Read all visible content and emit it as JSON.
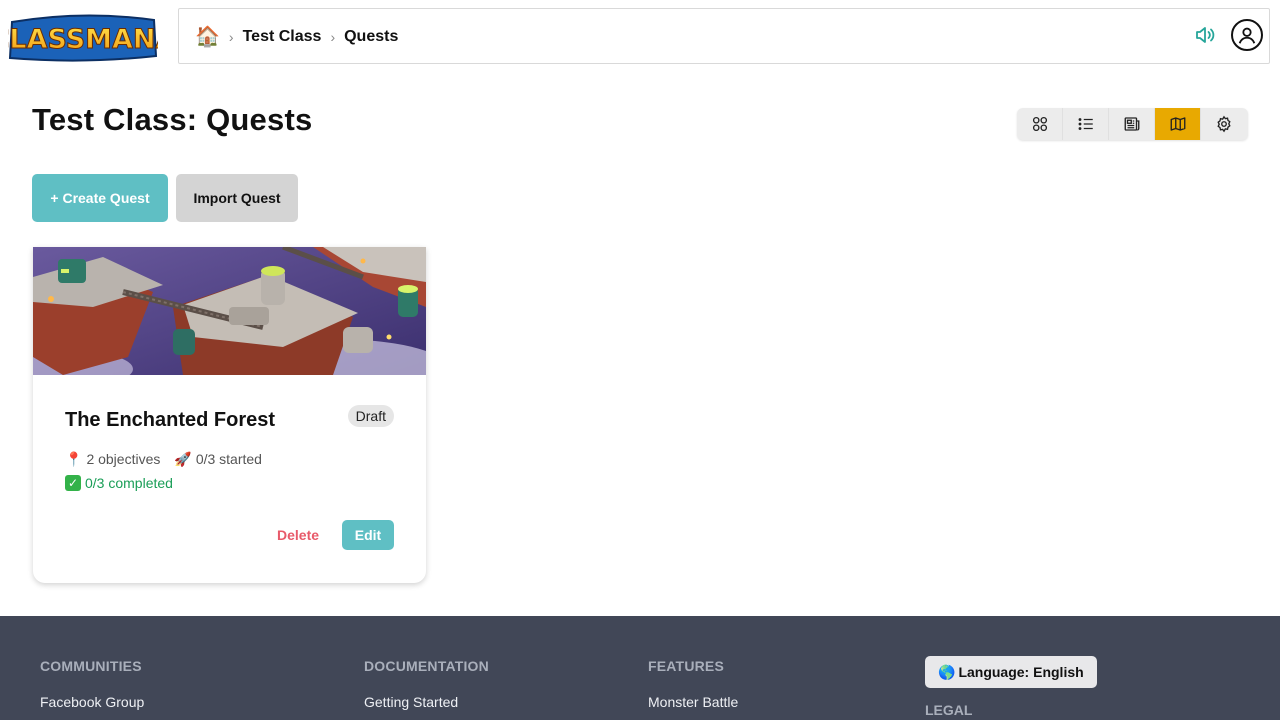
{
  "app": {
    "logo_text": "CLASSMANA"
  },
  "breadcrumb": {
    "home_icon": "house-icon",
    "items": [
      {
        "label": "Test Class"
      },
      {
        "label": "Quests"
      }
    ]
  },
  "page": {
    "title": "Test Class: Quests"
  },
  "view_toggle": {
    "buttons": [
      {
        "icon": "grid-icon",
        "active": false
      },
      {
        "icon": "list-icon",
        "active": false
      },
      {
        "icon": "newspaper-icon",
        "active": false
      },
      {
        "icon": "map-icon",
        "active": true
      },
      {
        "icon": "gear-icon",
        "active": false
      }
    ],
    "active_color": "#e8a901"
  },
  "actions": {
    "create_label": "+ Create Quest",
    "import_label": "Import Quest"
  },
  "quests": [
    {
      "title": "The Enchanted Forest",
      "status": "Draft",
      "objectives": "2 objectives",
      "started": "0/3 started",
      "completed": "0/3 completed",
      "delete_label": "Delete",
      "edit_label": "Edit"
    }
  ],
  "footer": {
    "communities": {
      "heading": "COMMUNITIES",
      "link": "Facebook Group"
    },
    "documentation": {
      "heading": "DOCUMENTATION",
      "link": "Getting Started"
    },
    "features": {
      "heading": "FEATURES",
      "link": "Monster Battle"
    },
    "language_label": "Language: English",
    "legal_heading": "LEGAL"
  },
  "colors": {
    "accent": "#5fbfc4",
    "footer_bg": "#414757",
    "delete": "#e85a6a",
    "completed": "#1a9e57"
  }
}
